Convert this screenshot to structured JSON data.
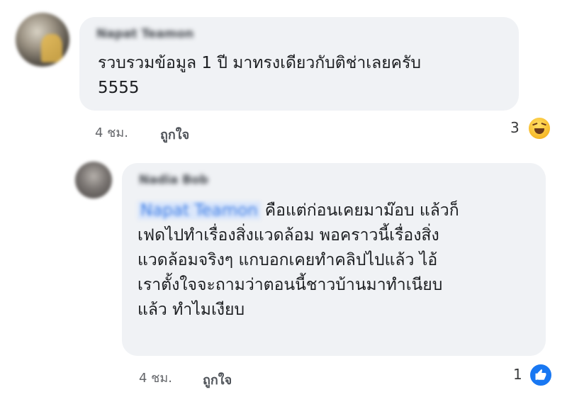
{
  "comments": [
    {
      "author": "Napat Teamon",
      "text": "รวบรวมข้อมูล 1 ปี มาทรงเดียวกับติช่าเลยครับ\n5555",
      "time": "4 ชม.",
      "like_label": "ถูกใจ",
      "reaction_count": "3",
      "reaction_icon": "haha-emoji-icon"
    },
    {
      "author": "Nadia Bob",
      "mention": "Napat Teamon",
      "text": "คือแต่ก่อนเคยมาม๊อบ แล้วก็\nเฟดไปทำเรื่องสิ่งแวดล้อม พอคราวนี้เรื่องสิ่ง\nแวดล้อมจริงๆ แกบอกเคยทำคลิปไปแล้ว ไอ้\nเราตั้งใจจะถามว่าตอนนี้ชาวบ้านมาทำเนียบ\nแล้ว ทำไมเงียบ",
      "time": "4 ชม.",
      "like_label": "ถูกใจ",
      "reaction_count": "1",
      "reaction_icon": "like-thumb-icon"
    }
  ],
  "colors": {
    "bubble": "#f0f2f5",
    "mention": "#3578e5",
    "like_reaction": "#1877f2",
    "haha_reaction": "#f7b928"
  }
}
